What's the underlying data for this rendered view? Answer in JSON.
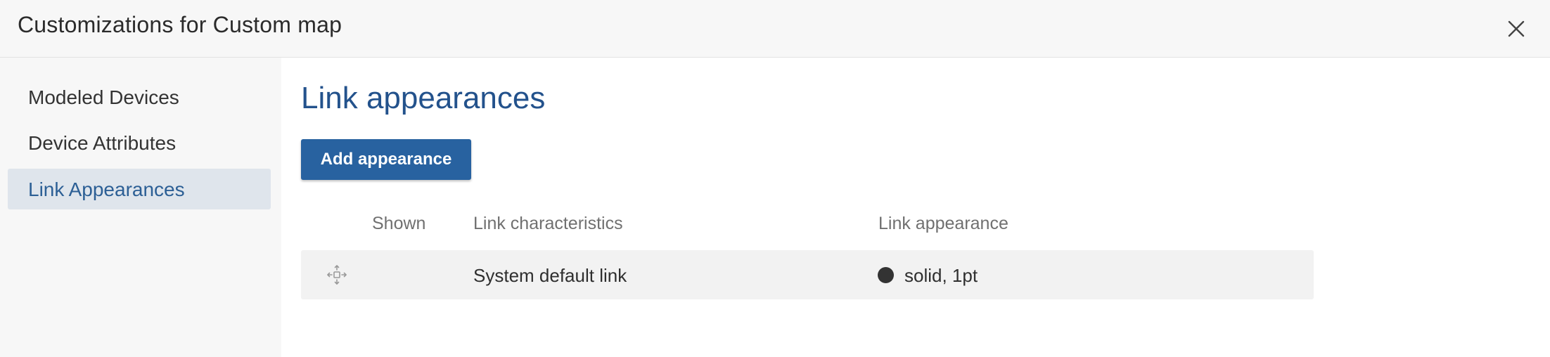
{
  "dialog": {
    "title": "Customizations for Custom map",
    "close_icon": "close-icon"
  },
  "sidebar": {
    "items": [
      {
        "label": "Modeled Devices",
        "active": false
      },
      {
        "label": "Device Attributes",
        "active": false
      },
      {
        "label": "Link Appearances",
        "active": true
      }
    ]
  },
  "main": {
    "title": "Link appearances",
    "add_button_label": "Add appearance",
    "table": {
      "columns": [
        "Shown",
        "Link characteristics",
        "Link appearance"
      ],
      "rows": [
        {
          "handle_icon": "drag-move-icon",
          "shown": "",
          "characteristics": "System default link",
          "appearance": "solid, 1pt",
          "swatch_color": "#333333"
        }
      ]
    }
  },
  "colors": {
    "accent": "#2862a0",
    "title": "#23528c",
    "active_item_bg": "#dfe5ec",
    "active_item_text": "#2c5f95",
    "sidebar_bg": "#f7f7f7",
    "row_bg": "#f2f2f2"
  }
}
